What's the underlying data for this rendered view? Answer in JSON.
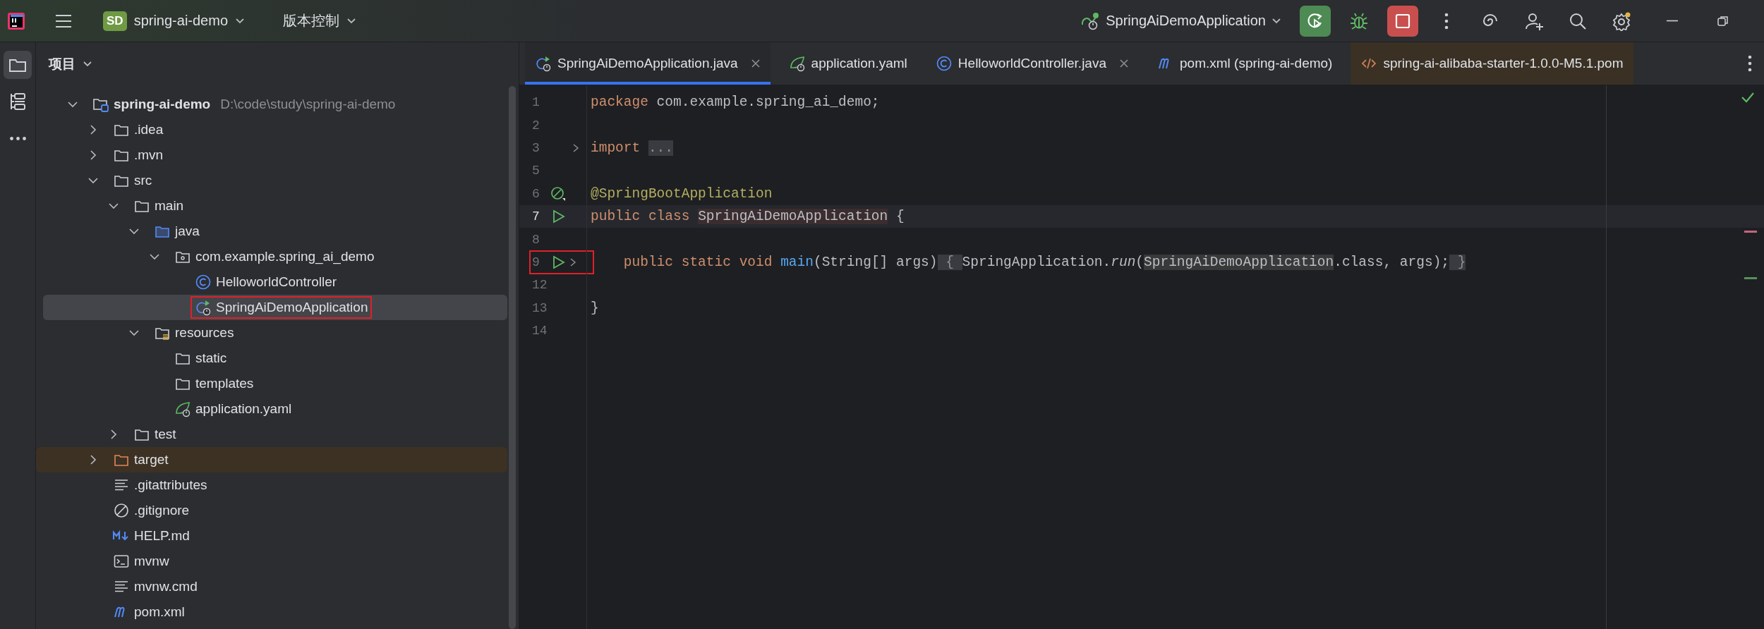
{
  "toolbar": {
    "project_badge": "SD",
    "project_name": "spring-ai-demo",
    "vcs_menu": "版本控制",
    "run_config": "SpringAiDemoApplication"
  },
  "sidebar": {
    "items": [
      {
        "kind": "folder",
        "selected": true
      },
      {
        "kind": "structure",
        "selected": false
      },
      {
        "kind": "more",
        "selected": false
      }
    ]
  },
  "project_panel": {
    "title": "项目",
    "tree": [
      {
        "kind": "module",
        "label": "spring-ai-demo",
        "path": "D:\\code\\study\\spring-ai-demo",
        "expanded": true,
        "selected": false,
        "children": [
          {
            "kind": "folder",
            "label": ".idea",
            "expanded": false,
            "selected": false
          },
          {
            "kind": "folder",
            "label": ".mvn",
            "expanded": false,
            "selected": false
          },
          {
            "kind": "folder",
            "label": "src",
            "expanded": true,
            "selected": false,
            "children": [
              {
                "kind": "folder",
                "label": "main",
                "expanded": true,
                "selected": false,
                "children": [
                  {
                    "kind": "source",
                    "label": "java",
                    "expanded": true,
                    "selected": false,
                    "children": [
                      {
                        "kind": "package",
                        "label": "com.example.spring_ai_demo",
                        "expanded": true,
                        "selected": false,
                        "children": [
                          {
                            "kind": "class",
                            "label": "HelloworldController",
                            "selected": false
                          },
                          {
                            "kind": "boot-class",
                            "label": "SpringAiDemoApplication",
                            "selected": true,
                            "annotated": true
                          }
                        ]
                      }
                    ]
                  },
                  {
                    "kind": "resources",
                    "label": "resources",
                    "expanded": true,
                    "selected": false,
                    "children": [
                      {
                        "kind": "folder",
                        "label": "static",
                        "selected": false
                      },
                      {
                        "kind": "folder",
                        "label": "templates",
                        "selected": false
                      },
                      {
                        "kind": "yaml",
                        "label": "application.yaml",
                        "selected": false
                      }
                    ]
                  }
                ]
              },
              {
                "kind": "folder",
                "label": "test",
                "expanded": false,
                "selected": false
              }
            ]
          },
          {
            "kind": "folder",
            "label": "target",
            "expanded": false,
            "selected": false,
            "excluded": true
          },
          {
            "kind": "text",
            "label": ".gitattributes",
            "selected": false
          },
          {
            "kind": "ignore",
            "label": ".gitignore",
            "selected": false
          },
          {
            "kind": "markdown",
            "label": "HELP.md",
            "selected": false
          },
          {
            "kind": "shell",
            "label": "mvnw",
            "selected": false
          },
          {
            "kind": "text",
            "label": "mvnw.cmd",
            "selected": false
          },
          {
            "kind": "maven",
            "label": "pom.xml",
            "selected": false
          }
        ]
      }
    ]
  },
  "editor": {
    "tabs": [
      {
        "kind": "boot-class",
        "label": "SpringAiDemoApplication.java",
        "selected": true,
        "closable": true
      },
      {
        "kind": "yaml",
        "label": "application.yaml",
        "selected": false
      },
      {
        "kind": "class",
        "label": "HelloworldController.java",
        "selected": false,
        "closable": true
      },
      {
        "kind": "maven",
        "label": "pom.xml (spring-ai-demo)",
        "selected": false
      },
      {
        "kind": "xml",
        "label": "spring-ai-alibaba-starter-1.0.0-M5.1.pom",
        "selected": false,
        "external": true
      }
    ],
    "lines": [
      {
        "number": "1",
        "tokens": [
          {
            "text": "package",
            "kind": "keyword"
          },
          {
            "text": " com.example.spring_ai_demo;",
            "kind": "plain"
          }
        ]
      },
      {
        "number": "2"
      },
      {
        "number": "3",
        "gutter": [
          {
            "kind": "fold"
          }
        ],
        "tokens": [
          {
            "text": "import ",
            "kind": "keyword"
          },
          {
            "text": "...",
            "kind": "folded"
          }
        ]
      },
      {
        "number": "5"
      },
      {
        "number": "6",
        "gutter": [
          {
            "kind": "bean"
          }
        ],
        "tokens": [
          {
            "text": "@SpringBootApplication",
            "kind": "annotation"
          }
        ]
      },
      {
        "number": "7",
        "current": true,
        "gutter": [
          {
            "kind": "run"
          }
        ],
        "tokens": [
          {
            "text": "public class ",
            "kind": "keyword"
          },
          {
            "text": "SpringAiDemoApplication",
            "kind": "declaration"
          },
          {
            "text": " {",
            "kind": "plain"
          }
        ]
      },
      {
        "number": "8"
      },
      {
        "number": "9",
        "annotated": true,
        "gutter": [
          {
            "kind": "run"
          },
          {
            "kind": "fold"
          }
        ],
        "tokens": [
          {
            "text": "    public static void ",
            "kind": "keyword"
          },
          {
            "text": "main",
            "kind": "method"
          },
          {
            "text": "(String[] args)",
            "kind": "plain"
          },
          {
            "text": " { ",
            "kind": "folded"
          },
          {
            "text": "SpringApplication.",
            "kind": "plain"
          },
          {
            "text": "run",
            "kind": "static-call"
          },
          {
            "text": "(",
            "kind": "plain"
          },
          {
            "text": "SpringAiDemoApplication",
            "kind": "usage"
          },
          {
            "text": ".class, args);",
            "kind": "plain"
          },
          {
            "text": " }",
            "kind": "folded"
          }
        ]
      },
      {
        "number": "12"
      },
      {
        "number": "13",
        "tokens": [
          {
            "text": "}",
            "kind": "plain"
          }
        ]
      },
      {
        "number": "14"
      }
    ],
    "inspection_ok": true
  }
}
